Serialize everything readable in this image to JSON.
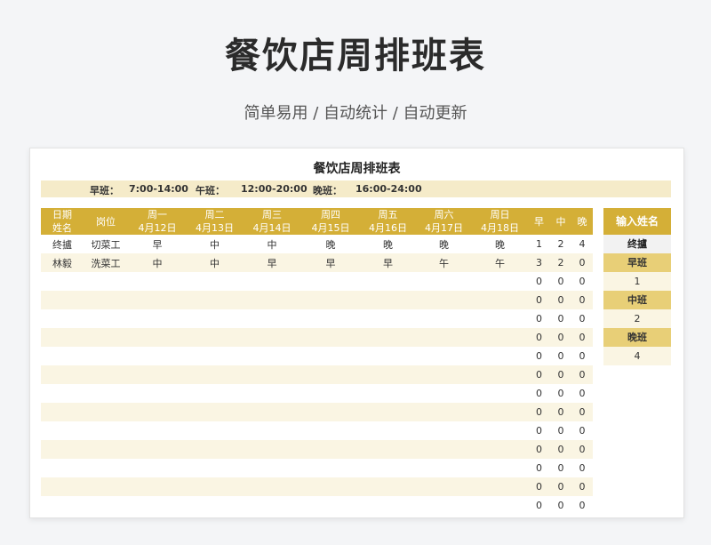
{
  "page": {
    "title": "餐饮店周排班表",
    "subtitle": "简单易用 / 自动统计 / 自动更新"
  },
  "sheet": {
    "title": "餐饮店周排班表",
    "shifts": [
      {
        "label": "早班：",
        "time": "7:00-14:00"
      },
      {
        "label": "午班：",
        "time": "12:00-20:00"
      },
      {
        "label": "晚班：",
        "time": "16:00-24:00"
      }
    ],
    "headers": {
      "date_name": [
        "日期",
        "姓名"
      ],
      "position": "岗位",
      "days": [
        {
          "weekday": "周一",
          "date": "4月12日"
        },
        {
          "weekday": "周二",
          "date": "4月13日"
        },
        {
          "weekday": "周三",
          "date": "4月14日"
        },
        {
          "weekday": "周四",
          "date": "4月15日"
        },
        {
          "weekday": "周五",
          "date": "4月16日"
        },
        {
          "weekday": "周六",
          "date": "4月17日"
        },
        {
          "weekday": "周日",
          "date": "4月18日"
        }
      ],
      "counts": [
        "早",
        "中",
        "晚"
      ]
    },
    "rows": [
      {
        "name": "终攎",
        "position": "切菜工",
        "days": [
          "早",
          "中",
          "中",
          "晚",
          "晚",
          "晚",
          "晚"
        ],
        "counts": [
          "1",
          "2",
          "4"
        ]
      },
      {
        "name": "林毅",
        "position": "洗菜工",
        "days": [
          "中",
          "中",
          "早",
          "早",
          "早",
          "午",
          "午"
        ],
        "counts": [
          "3",
          "2",
          "0"
        ]
      },
      {
        "name": "",
        "position": "",
        "days": [
          "",
          "",
          "",
          "",
          "",
          "",
          ""
        ],
        "counts": [
          "0",
          "0",
          "0"
        ]
      },
      {
        "name": "",
        "position": "",
        "days": [
          "",
          "",
          "",
          "",
          "",
          "",
          ""
        ],
        "counts": [
          "0",
          "0",
          "0"
        ]
      },
      {
        "name": "",
        "position": "",
        "days": [
          "",
          "",
          "",
          "",
          "",
          "",
          ""
        ],
        "counts": [
          "0",
          "0",
          "0"
        ]
      },
      {
        "name": "",
        "position": "",
        "days": [
          "",
          "",
          "",
          "",
          "",
          "",
          ""
        ],
        "counts": [
          "0",
          "0",
          "0"
        ]
      },
      {
        "name": "",
        "position": "",
        "days": [
          "",
          "",
          "",
          "",
          "",
          "",
          ""
        ],
        "counts": [
          "0",
          "0",
          "0"
        ]
      },
      {
        "name": "",
        "position": "",
        "days": [
          "",
          "",
          "",
          "",
          "",
          "",
          ""
        ],
        "counts": [
          "0",
          "0",
          "0"
        ]
      },
      {
        "name": "",
        "position": "",
        "days": [
          "",
          "",
          "",
          "",
          "",
          "",
          ""
        ],
        "counts": [
          "0",
          "0",
          "0"
        ]
      },
      {
        "name": "",
        "position": "",
        "days": [
          "",
          "",
          "",
          "",
          "",
          "",
          ""
        ],
        "counts": [
          "0",
          "0",
          "0"
        ]
      },
      {
        "name": "",
        "position": "",
        "days": [
          "",
          "",
          "",
          "",
          "",
          "",
          ""
        ],
        "counts": [
          "0",
          "0",
          "0"
        ]
      },
      {
        "name": "",
        "position": "",
        "days": [
          "",
          "",
          "",
          "",
          "",
          "",
          ""
        ],
        "counts": [
          "0",
          "0",
          "0"
        ]
      },
      {
        "name": "",
        "position": "",
        "days": [
          "",
          "",
          "",
          "",
          "",
          "",
          ""
        ],
        "counts": [
          "0",
          "0",
          "0"
        ]
      },
      {
        "name": "",
        "position": "",
        "days": [
          "",
          "",
          "",
          "",
          "",
          "",
          ""
        ],
        "counts": [
          "0",
          "0",
          "0"
        ]
      },
      {
        "name": "",
        "position": "",
        "days": [
          "",
          "",
          "",
          "",
          "",
          "",
          ""
        ],
        "counts": [
          "0",
          "0",
          "0"
        ]
      }
    ],
    "lookup": {
      "header": "输入姓名",
      "name": "终攎",
      "items": [
        {
          "label": "早班",
          "value": "1"
        },
        {
          "label": "中班",
          "value": "2"
        },
        {
          "label": "晚班",
          "value": "4"
        }
      ]
    }
  }
}
